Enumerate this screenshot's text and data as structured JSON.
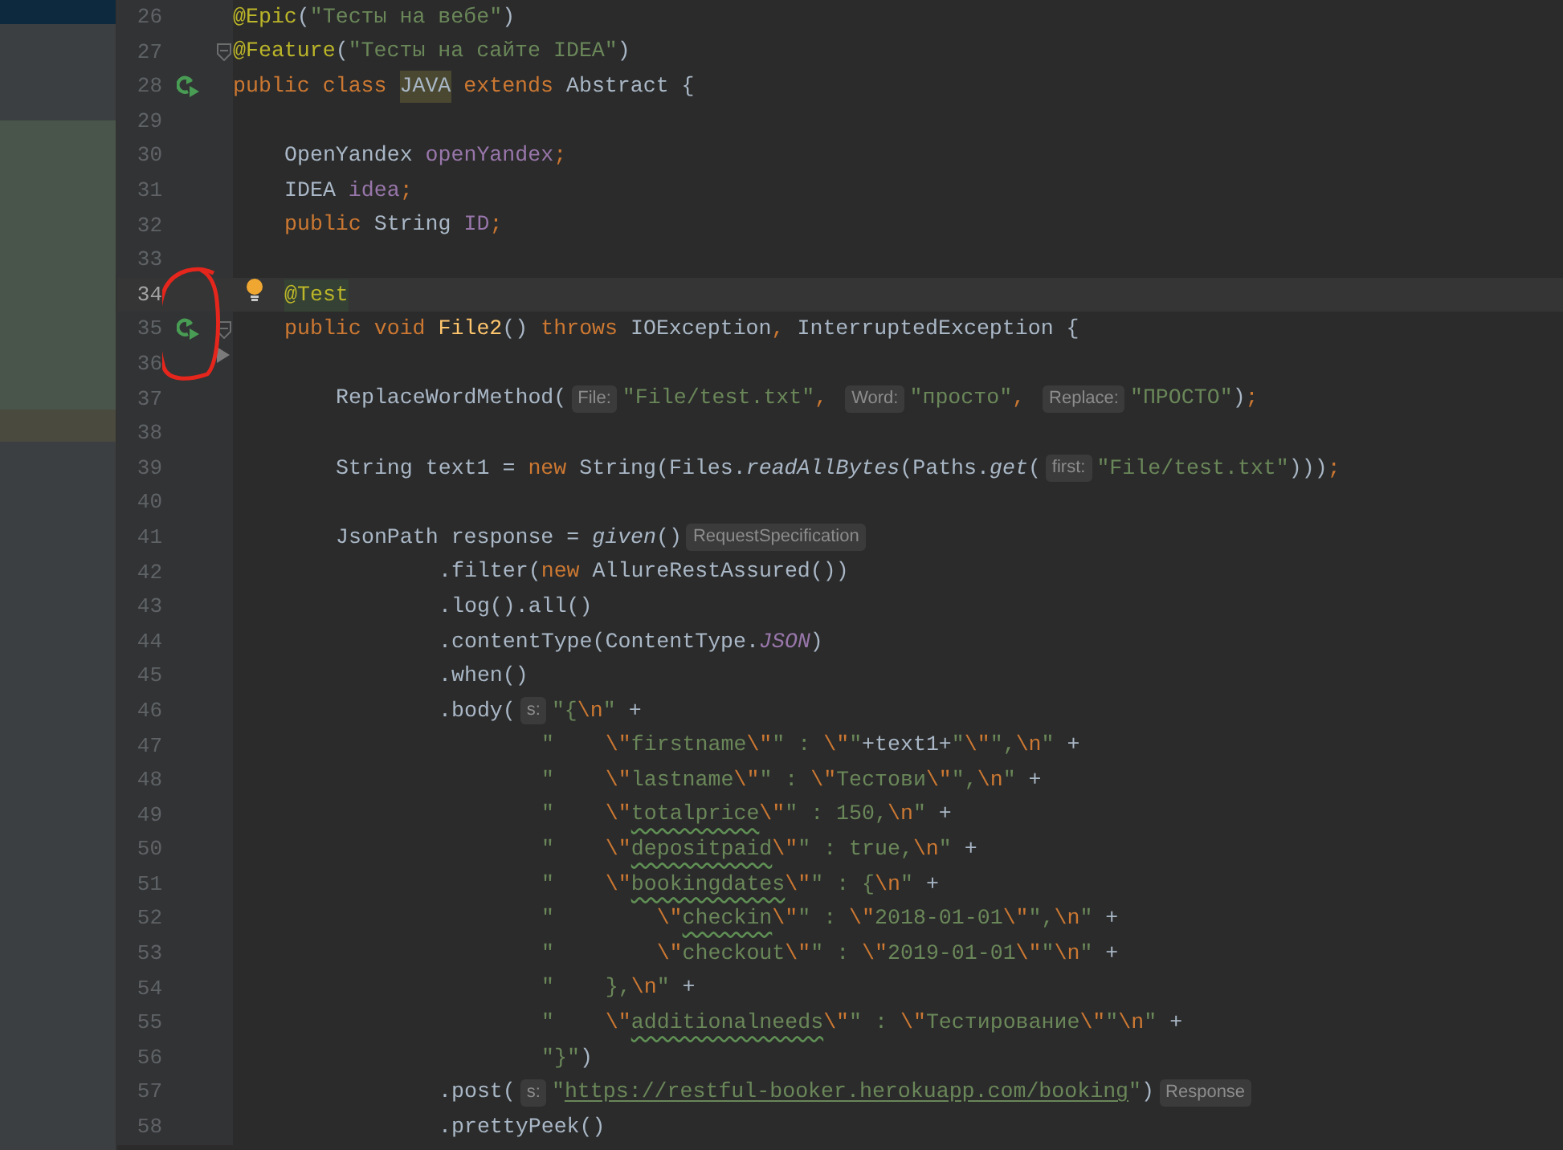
{
  "editor": {
    "lines": [
      {
        "number": "26",
        "kind": "top",
        "current": false,
        "tokens": [
          {
            "kind": "annotation",
            "text": "@Epic"
          },
          {
            "kind": "plain",
            "text": "("
          },
          {
            "kind": "string",
            "text": "\"Тесты на вебе\""
          },
          {
            "kind": "plain",
            "text": ")"
          }
        ]
      },
      {
        "number": "27",
        "kind": "top",
        "current": false,
        "markers": [
          {
            "kind": "fold"
          }
        ],
        "tokens": [
          {
            "kind": "annotation",
            "text": "@Feature"
          },
          {
            "kind": "plain",
            "text": "("
          },
          {
            "kind": "string",
            "text": "\"Тесты на сайте IDEA\""
          },
          {
            "kind": "plain",
            "text": ")"
          }
        ]
      },
      {
        "number": "28",
        "kind": "top",
        "current": false,
        "markers": [
          {
            "kind": "run"
          }
        ],
        "tokens": [
          {
            "kind": "keyword",
            "text": "public class "
          },
          {
            "kind": "usage",
            "text": "JAVA"
          },
          {
            "kind": "keyword",
            "text": " extends "
          },
          {
            "kind": "plain",
            "text": "Abstract {"
          }
        ]
      },
      {
        "number": "29",
        "kind": "blank",
        "current": false
      },
      {
        "number": "30",
        "kind": "member",
        "current": false,
        "tokens": [
          {
            "kind": "plain",
            "text": "OpenYandex "
          },
          {
            "kind": "field",
            "text": "openYandex"
          },
          {
            "kind": "keyword",
            "text": ";"
          }
        ]
      },
      {
        "number": "31",
        "kind": "member",
        "current": false,
        "tokens": [
          {
            "kind": "plain",
            "text": "IDEA "
          },
          {
            "kind": "field",
            "text": "idea"
          },
          {
            "kind": "keyword",
            "text": ";"
          }
        ]
      },
      {
        "number": "32",
        "kind": "member",
        "current": false,
        "tokens": [
          {
            "kind": "keyword",
            "text": "public "
          },
          {
            "kind": "plain",
            "text": "String "
          },
          {
            "kind": "field",
            "text": "ID"
          },
          {
            "kind": "keyword",
            "text": ";"
          }
        ]
      },
      {
        "number": "33",
        "kind": "blank",
        "current": false
      },
      {
        "number": "34",
        "kind": "member",
        "current": true,
        "markers": [
          {
            "kind": "intention"
          }
        ],
        "tokens": [
          {
            "kind": "marked",
            "text": "@Test"
          }
        ]
      },
      {
        "number": "35",
        "kind": "member",
        "current": false,
        "markers": [
          {
            "kind": "run"
          },
          {
            "kind": "fold"
          }
        ],
        "tokens": [
          {
            "kind": "keyword",
            "text": "public void "
          },
          {
            "kind": "method",
            "text": "File2"
          },
          {
            "kind": "plain",
            "text": "() "
          },
          {
            "kind": "keyword",
            "text": "throws "
          },
          {
            "kind": "plain",
            "text": "IOException"
          },
          {
            "kind": "keyword",
            "text": ", "
          },
          {
            "kind": "plain",
            "text": "InterruptedException {"
          }
        ]
      },
      {
        "number": "36",
        "kind": "blank",
        "current": false,
        "markers": [
          {
            "kind": "pointer"
          }
        ]
      },
      {
        "number": "37",
        "kind": "statement",
        "current": false,
        "tokens": [
          {
            "kind": "plain",
            "text": "ReplaceWordMethod("
          },
          {
            "kind": "hint",
            "text": "File:"
          },
          {
            "kind": "string",
            "text": "\"File/test.txt\""
          },
          {
            "kind": "keyword",
            "text": ", "
          },
          {
            "kind": "hint",
            "text": "Word:"
          },
          {
            "kind": "string",
            "text": "\"просто\""
          },
          {
            "kind": "keyword",
            "text": ", "
          },
          {
            "kind": "hint",
            "text": "Replace:"
          },
          {
            "kind": "string",
            "text": "\"ПРОСТО\""
          },
          {
            "kind": "plain",
            "text": ")"
          },
          {
            "kind": "keyword",
            "text": ";"
          }
        ]
      },
      {
        "number": "38",
        "kind": "blank",
        "current": false
      },
      {
        "number": "39",
        "kind": "statement",
        "current": false,
        "tokens": [
          {
            "kind": "plain",
            "text": "String text1 = "
          },
          {
            "kind": "keyword",
            "text": "new "
          },
          {
            "kind": "plain",
            "text": "String(Files."
          },
          {
            "kind": "static",
            "text": "readAllBytes"
          },
          {
            "kind": "plain",
            "text": "(Paths."
          },
          {
            "kind": "static",
            "text": "get"
          },
          {
            "kind": "plain",
            "text": "("
          },
          {
            "kind": "hint",
            "text": "first:"
          },
          {
            "kind": "string",
            "text": "\"File/test.txt\""
          },
          {
            "kind": "plain",
            "text": ")))"
          },
          {
            "kind": "keyword",
            "text": ";"
          }
        ]
      },
      {
        "number": "40",
        "kind": "blank",
        "current": false
      },
      {
        "number": "41",
        "kind": "statement",
        "current": false,
        "tokens": [
          {
            "kind": "plain",
            "text": "JsonPath response = "
          },
          {
            "kind": "static",
            "text": "given"
          },
          {
            "kind": "plain",
            "text": "()"
          },
          {
            "kind": "hint",
            "text": "RequestSpecification"
          }
        ]
      },
      {
        "number": "42",
        "kind": "chain",
        "current": false,
        "tokens": [
          {
            "kind": "plain",
            "text": ".filter("
          },
          {
            "kind": "keyword",
            "text": "new "
          },
          {
            "kind": "plain",
            "text": "AllureRestAssured())"
          }
        ]
      },
      {
        "number": "43",
        "kind": "chain",
        "current": false,
        "tokens": [
          {
            "kind": "plain",
            "text": ".log().all()"
          }
        ]
      },
      {
        "number": "44",
        "kind": "chain",
        "current": false,
        "tokens": [
          {
            "kind": "plain",
            "text": ".contentType(ContentType."
          },
          {
            "kind": "constant",
            "text": "JSON"
          },
          {
            "kind": "plain",
            "text": ")"
          }
        ]
      },
      {
        "number": "45",
        "kind": "chain",
        "current": false,
        "tokens": [
          {
            "kind": "plain",
            "text": ".when()"
          }
        ]
      },
      {
        "number": "46",
        "kind": "chain",
        "current": false,
        "tokens": [
          {
            "kind": "plain",
            "text": ".body("
          },
          {
            "kind": "hint",
            "text": "s:"
          },
          {
            "kind": "string",
            "text": "\"{"
          },
          {
            "kind": "escape",
            "text": "\\n"
          },
          {
            "kind": "string",
            "text": "\""
          },
          {
            "kind": "plain",
            "text": " +"
          }
        ]
      },
      {
        "number": "47",
        "kind": "literal",
        "current": false,
        "tokens": [
          {
            "kind": "string",
            "text": "\"    "
          },
          {
            "kind": "escape",
            "text": "\\\""
          },
          {
            "kind": "string",
            "text": "firstname"
          },
          {
            "kind": "escape",
            "text": "\\\""
          },
          {
            "kind": "string",
            "text": "\" : "
          },
          {
            "kind": "escape",
            "text": "\\\""
          },
          {
            "kind": "string",
            "text": "\""
          },
          {
            "kind": "plain",
            "text": "+text1+"
          },
          {
            "kind": "string",
            "text": "\""
          },
          {
            "kind": "escape",
            "text": "\\\""
          },
          {
            "kind": "string",
            "text": "\","
          },
          {
            "kind": "escape",
            "text": "\\n"
          },
          {
            "kind": "string",
            "text": "\""
          },
          {
            "kind": "plain",
            "text": " +"
          }
        ]
      },
      {
        "number": "48",
        "kind": "literal",
        "current": false,
        "tokens": [
          {
            "kind": "string",
            "text": "\"    "
          },
          {
            "kind": "escape",
            "text": "\\\""
          },
          {
            "kind": "string",
            "text": "lastname"
          },
          {
            "kind": "escape",
            "text": "\\\""
          },
          {
            "kind": "string",
            "text": "\" : "
          },
          {
            "kind": "escape",
            "text": "\\\""
          },
          {
            "kind": "string",
            "text": "Тестови"
          },
          {
            "kind": "escape",
            "text": "\\\""
          },
          {
            "kind": "string",
            "text": "\","
          },
          {
            "kind": "escape",
            "text": "\\n"
          },
          {
            "kind": "string",
            "text": "\""
          },
          {
            "kind": "plain",
            "text": " +"
          }
        ]
      },
      {
        "number": "49",
        "kind": "literal",
        "current": false,
        "tokens": [
          {
            "kind": "string",
            "text": "\"    "
          },
          {
            "kind": "escape",
            "text": "\\\""
          },
          {
            "kind": "typo",
            "text": "totalprice"
          },
          {
            "kind": "escape",
            "text": "\\\""
          },
          {
            "kind": "string",
            "text": "\" : 150,"
          },
          {
            "kind": "escape",
            "text": "\\n"
          },
          {
            "kind": "string",
            "text": "\""
          },
          {
            "kind": "plain",
            "text": " +"
          }
        ]
      },
      {
        "number": "50",
        "kind": "literal",
        "current": false,
        "tokens": [
          {
            "kind": "string",
            "text": "\"    "
          },
          {
            "kind": "escape",
            "text": "\\\""
          },
          {
            "kind": "typo",
            "text": "depositpaid"
          },
          {
            "kind": "escape",
            "text": "\\\""
          },
          {
            "kind": "string",
            "text": "\" : true,"
          },
          {
            "kind": "escape",
            "text": "\\n"
          },
          {
            "kind": "string",
            "text": "\""
          },
          {
            "kind": "plain",
            "text": " +"
          }
        ]
      },
      {
        "number": "51",
        "kind": "literal",
        "current": false,
        "tokens": [
          {
            "kind": "string",
            "text": "\"    "
          },
          {
            "kind": "escape",
            "text": "\\\""
          },
          {
            "kind": "typo",
            "text": "bookingdates"
          },
          {
            "kind": "escape",
            "text": "\\\""
          },
          {
            "kind": "string",
            "text": "\" : {"
          },
          {
            "kind": "escape",
            "text": "\\n"
          },
          {
            "kind": "string",
            "text": "\""
          },
          {
            "kind": "plain",
            "text": " +"
          }
        ]
      },
      {
        "number": "52",
        "kind": "literal",
        "current": false,
        "tokens": [
          {
            "kind": "string",
            "text": "\"        "
          },
          {
            "kind": "escape",
            "text": "\\\""
          },
          {
            "kind": "typo",
            "text": "checkin"
          },
          {
            "kind": "escape",
            "text": "\\\""
          },
          {
            "kind": "string",
            "text": "\" : "
          },
          {
            "kind": "escape",
            "text": "\\\""
          },
          {
            "kind": "string",
            "text": "2018-01-01"
          },
          {
            "kind": "escape",
            "text": "\\\""
          },
          {
            "kind": "string",
            "text": "\","
          },
          {
            "kind": "escape",
            "text": "\\n"
          },
          {
            "kind": "string",
            "text": "\""
          },
          {
            "kind": "plain",
            "text": " +"
          }
        ]
      },
      {
        "number": "53",
        "kind": "literal",
        "current": false,
        "tokens": [
          {
            "kind": "string",
            "text": "\"        "
          },
          {
            "kind": "escape",
            "text": "\\\""
          },
          {
            "kind": "string",
            "text": "checkout"
          },
          {
            "kind": "escape",
            "text": "\\\""
          },
          {
            "kind": "string",
            "text": "\" : "
          },
          {
            "kind": "escape",
            "text": "\\\""
          },
          {
            "kind": "string",
            "text": "2019-01-01"
          },
          {
            "kind": "escape",
            "text": "\\\""
          },
          {
            "kind": "string",
            "text": "\""
          },
          {
            "kind": "escape",
            "text": "\\n"
          },
          {
            "kind": "string",
            "text": "\""
          },
          {
            "kind": "plain",
            "text": " +"
          }
        ]
      },
      {
        "number": "54",
        "kind": "literal",
        "current": false,
        "tokens": [
          {
            "kind": "string",
            "text": "\"    },"
          },
          {
            "kind": "escape",
            "text": "\\n"
          },
          {
            "kind": "string",
            "text": "\""
          },
          {
            "kind": "plain",
            "text": " +"
          }
        ]
      },
      {
        "number": "55",
        "kind": "literal",
        "current": false,
        "tokens": [
          {
            "kind": "string",
            "text": "\"    "
          },
          {
            "kind": "escape",
            "text": "\\\""
          },
          {
            "kind": "typo",
            "text": "additionalneeds"
          },
          {
            "kind": "escape",
            "text": "\\\""
          },
          {
            "kind": "string",
            "text": "\" : "
          },
          {
            "kind": "escape",
            "text": "\\\""
          },
          {
            "kind": "string",
            "text": "Тестирование"
          },
          {
            "kind": "escape",
            "text": "\\\""
          },
          {
            "kind": "string",
            "text": "\""
          },
          {
            "kind": "escape",
            "text": "\\n"
          },
          {
            "kind": "string",
            "text": "\""
          },
          {
            "kind": "plain",
            "text": " +"
          }
        ]
      },
      {
        "number": "56",
        "kind": "literal",
        "current": false,
        "tokens": [
          {
            "kind": "string",
            "text": "\"}\""
          },
          {
            "kind": "plain",
            "text": ")"
          }
        ]
      },
      {
        "number": "57",
        "kind": "chain",
        "current": false,
        "tokens": [
          {
            "kind": "plain",
            "text": ".post("
          },
          {
            "kind": "hint",
            "text": "s:"
          },
          {
            "kind": "string",
            "text": "\""
          },
          {
            "kind": "link",
            "text": "https://restful-booker.herokuapp.com/booking"
          },
          {
            "kind": "string",
            "text": "\""
          },
          {
            "kind": "plain",
            "text": ")"
          },
          {
            "kind": "hint",
            "text": "Response"
          }
        ]
      },
      {
        "number": "58",
        "kind": "chain",
        "current": false,
        "tokens": [
          {
            "kind": "plain",
            "text": ".prettyPeek()"
          }
        ]
      }
    ]
  }
}
